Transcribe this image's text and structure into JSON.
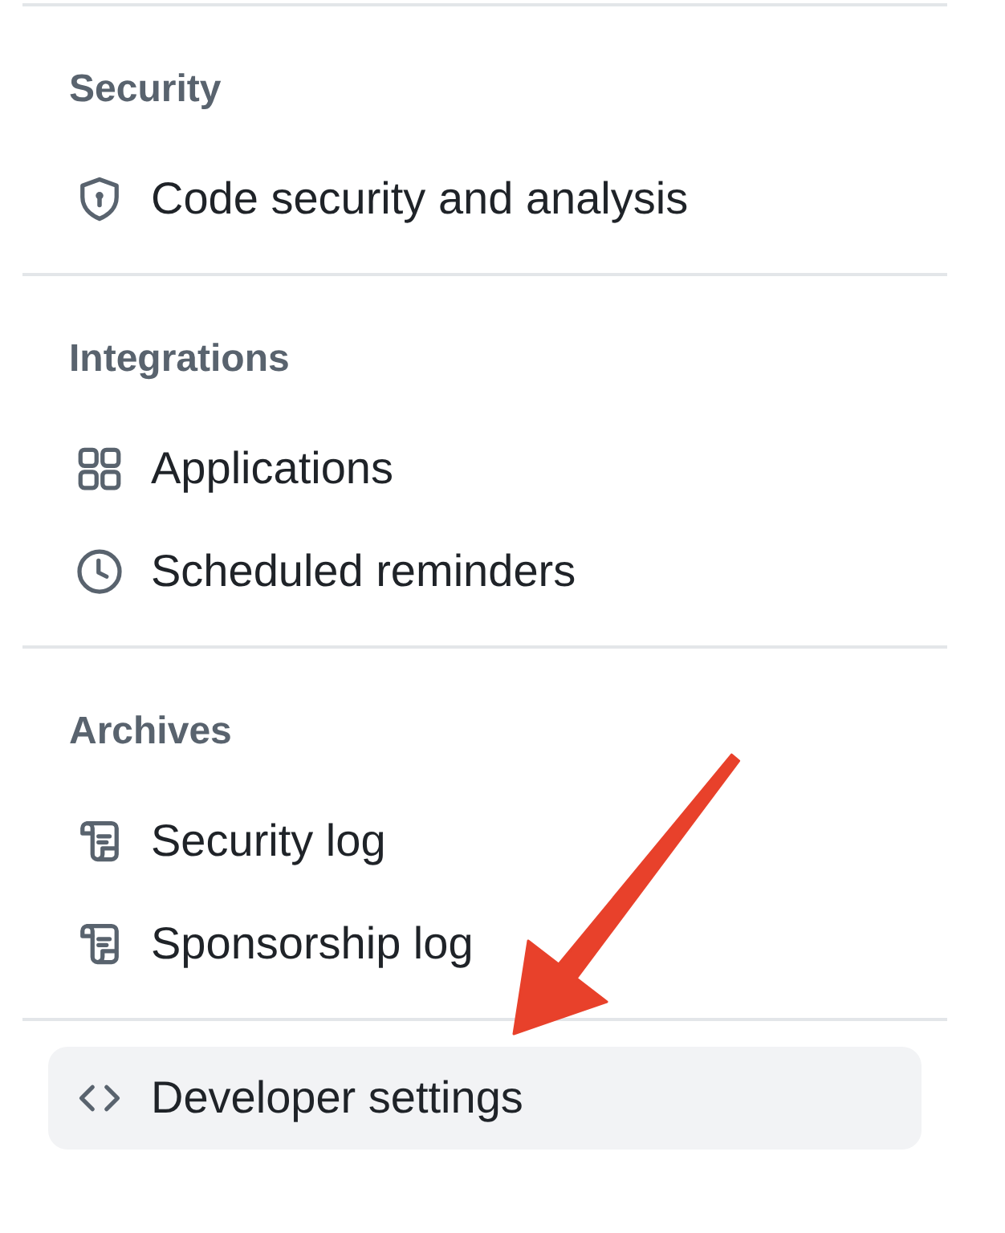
{
  "sections": [
    {
      "heading": "Security",
      "items": [
        {
          "kind": "shield",
          "label": "Code security and analysis",
          "selected": false
        }
      ]
    },
    {
      "heading": "Integrations",
      "items": [
        {
          "kind": "apps",
          "label": "Applications",
          "selected": false
        },
        {
          "kind": "clock",
          "label": "Scheduled reminders",
          "selected": false
        }
      ]
    },
    {
      "heading": "Archives",
      "items": [
        {
          "kind": "log",
          "label": "Security log",
          "selected": false
        },
        {
          "kind": "log",
          "label": "Sponsorship log",
          "selected": false
        }
      ]
    },
    {
      "items": [
        {
          "kind": "code",
          "label": "Developer settings",
          "selected": true
        }
      ]
    }
  ]
}
